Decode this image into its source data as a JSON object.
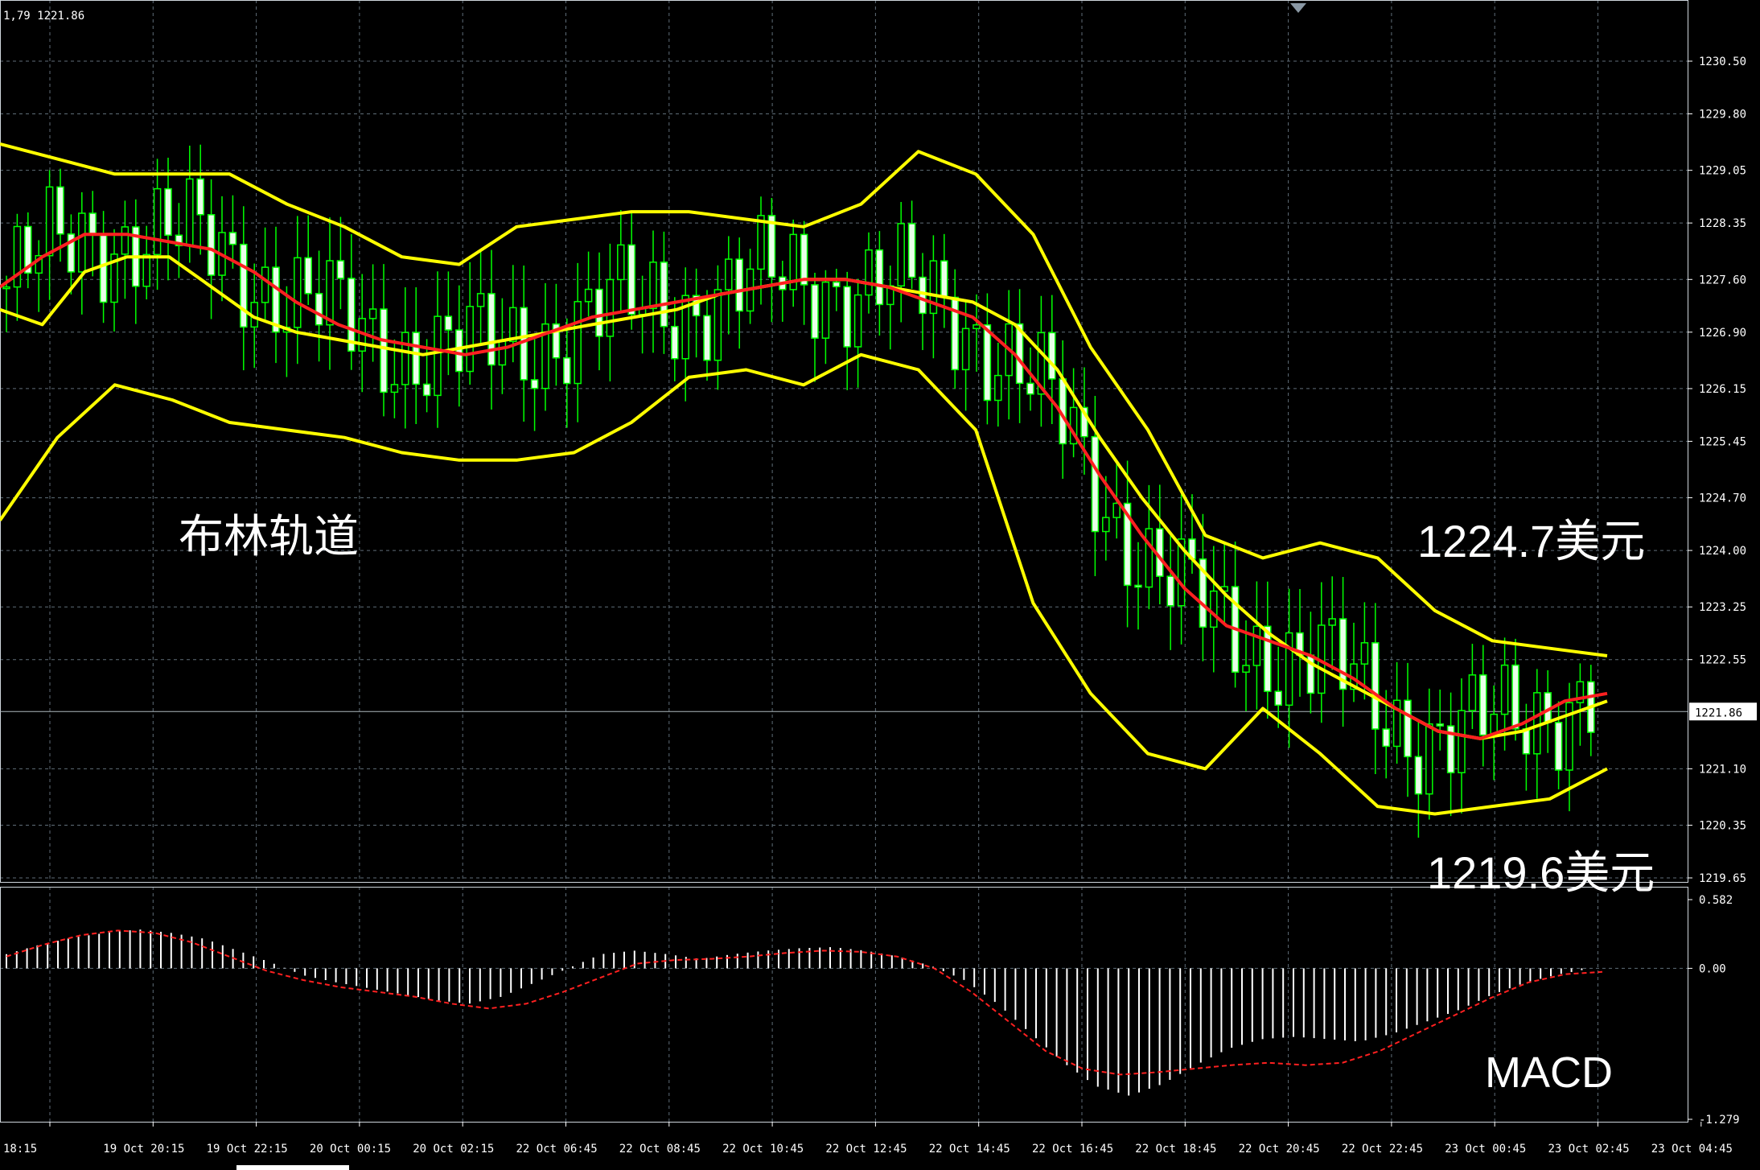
{
  "header": {
    "info": "1,79 1221.86"
  },
  "chart_data": [
    {
      "type": "candlestick",
      "title": "",
      "price_ticks": [
        "1230.50",
        "1229.80",
        "1229.05",
        "1228.35",
        "1227.60",
        "1226.90",
        "1226.15",
        "1225.45",
        "1224.70",
        "1224.00",
        "1223.25",
        "1222.55",
        "1221.10",
        "1220.35",
        "1219.65"
      ],
      "ylim": [
        1219.65,
        1230.5
      ],
      "current_price": "1221.86",
      "x_ticks": [
        "18:15",
        "19 Oct 20:15",
        "19 Oct 22:15",
        "20 Oct 00:15",
        "20 Oct 02:15",
        "22 Oct 06:45",
        "22 Oct 08:45",
        "22 Oct 10:45",
        "22 Oct 12:45",
        "22 Oct 14:45",
        "22 Oct 16:45",
        "22 Oct 18:45",
        "22 Oct 20:45",
        "22 Oct 22:45",
        "23 Oct 00:45",
        "23 Oct 02:45",
        "23 Oct 04:45"
      ],
      "series": [
        {
          "name": "",
          "color": "#ffff00",
          "values": [
            1227.2,
            1227.0,
            1227.7,
            1227.9,
            1227.9,
            1227.5,
            1227.1,
            1226.9,
            1226.8,
            1226.7,
            1226.6,
            1226.7,
            1226.8,
            1226.9,
            1227.0,
            1227.1,
            1227.2,
            1227.4,
            1227.5,
            1227.6,
            1227.6,
            1227.5,
            1227.4,
            1227.3,
            1227.0,
            1226.4,
            1225.5,
            1224.7,
            1224.0,
            1223.4,
            1222.9,
            1222.5,
            1222.2,
            1221.9,
            1221.6,
            1221.5,
            1221.6,
            1221.8,
            1222.0
          ]
        },
        {
          "name": "",
          "color": "#ff2020",
          "values": [
            1227.5,
            1227.9,
            1228.2,
            1228.2,
            1228.1,
            1228.0,
            1227.7,
            1227.3,
            1227.0,
            1226.8,
            1226.7,
            1226.6,
            1226.7,
            1226.9,
            1227.1,
            1227.2,
            1227.3,
            1227.4,
            1227.5,
            1227.6,
            1227.6,
            1227.5,
            1227.3,
            1227.1,
            1226.6,
            1225.9,
            1225.0,
            1224.2,
            1223.5,
            1223.0,
            1222.8,
            1222.6,
            1222.3,
            1221.9,
            1221.6,
            1221.5,
            1221.7,
            1222.0,
            1222.1
          ]
        },
        {
          "name": "",
          "color": "#ffff00",
          "values": [
            1229.4,
            1229.2,
            1229.0,
            1229.0,
            1229.0,
            1228.6,
            1228.3,
            1227.9,
            1227.8,
            1228.3,
            1228.4,
            1228.5,
            1228.5,
            1228.4,
            1228.3,
            1228.6,
            1229.3,
            1229.0,
            1228.2,
            1226.7,
            1225.6,
            1224.2,
            1223.9,
            1224.1,
            1223.9,
            1223.2,
            1222.8,
            1222.7,
            1222.6
          ]
        },
        {
          "name": "",
          "color": "#ffff00",
          "values": [
            1224.4,
            1225.5,
            1226.2,
            1226.0,
            1225.7,
            1225.6,
            1225.5,
            1225.3,
            1225.2,
            1225.2,
            1225.3,
            1225.7,
            1226.3,
            1226.4,
            1226.2,
            1226.6,
            1226.4,
            1225.6,
            1223.3,
            1222.1,
            1221.3,
            1221.1,
            1221.9,
            1221.3,
            1220.6,
            1220.5,
            1220.6,
            1220.7,
            1221.1
          ]
        }
      ]
    },
    {
      "type": "bar",
      "title": "MACD",
      "ticks": [
        "0.582",
        "0.00",
        "-1.279"
      ],
      "ylim": [
        -1.279,
        0.582
      ],
      "histogram": [
        0.12,
        0.2,
        0.26,
        0.3,
        0.33,
        0.3,
        0.25,
        0.15,
        0.05,
        -0.06,
        -0.12,
        -0.17,
        -0.22,
        -0.27,
        -0.3,
        -0.24,
        -0.12,
        0.0,
        0.12,
        0.15,
        0.12,
        0.08,
        0.12,
        0.15,
        0.17,
        0.18,
        0.15,
        0.1,
        0.02,
        -0.1,
        -0.3,
        -0.55,
        -0.8,
        -1.0,
        -1.08,
        -0.98,
        -0.82,
        -0.68,
        -0.6,
        -0.58,
        -0.6,
        -0.62,
        -0.55,
        -0.45,
        -0.35,
        -0.22,
        -0.12,
        -0.05,
        0.0
      ],
      "signal": [
        0.1,
        0.2,
        0.28,
        0.32,
        0.3,
        0.22,
        0.1,
        -0.02,
        -0.1,
        -0.16,
        -0.2,
        -0.24,
        -0.3,
        -0.34,
        -0.3,
        -0.2,
        -0.08,
        0.04,
        0.07,
        0.08,
        0.1,
        0.13,
        0.15,
        0.14,
        0.1,
        0.0,
        -0.2,
        -0.45,
        -0.7,
        -0.85,
        -0.9,
        -0.88,
        -0.85,
        -0.82,
        -0.8,
        -0.82,
        -0.8,
        -0.7,
        -0.55,
        -0.4,
        -0.25,
        -0.12,
        -0.05,
        -0.03
      ]
    }
  ],
  "annotations": {
    "bollinger": "布林轨道",
    "upper_value": "1224.7美元",
    "lower_value": "1219.6美元",
    "macd": "MACD"
  }
}
